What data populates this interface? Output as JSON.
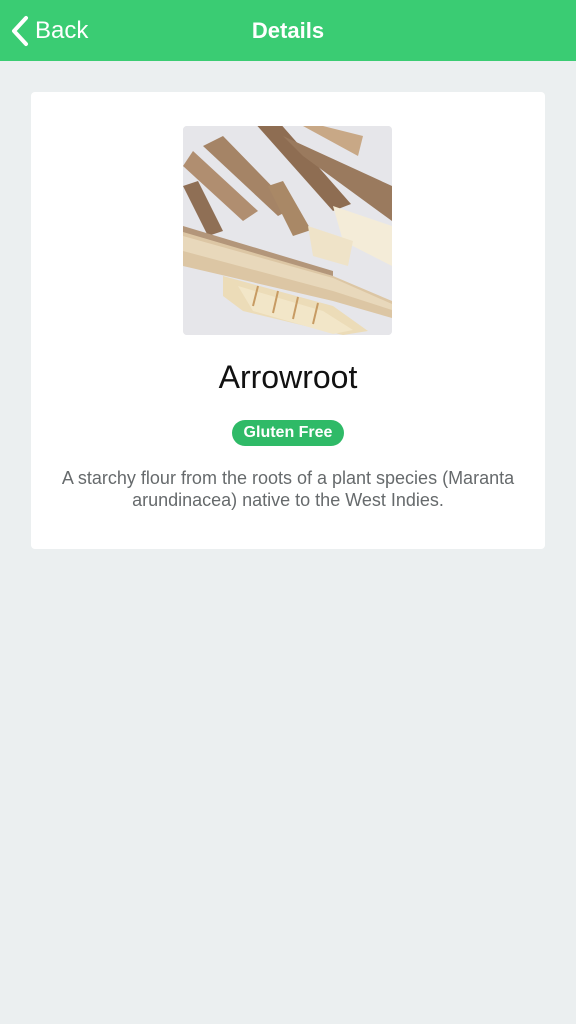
{
  "nav": {
    "back_label": "Back",
    "title": "Details",
    "background_color": "#3acc73",
    "back_icon": "chevron-left-icon"
  },
  "item": {
    "name": "Arrowroot",
    "badge": "Gluten Free",
    "badge_color": "#2fba67",
    "description": "A starchy flour from the roots of a plant species (Maranta arundinacea) native to the West Indies."
  }
}
